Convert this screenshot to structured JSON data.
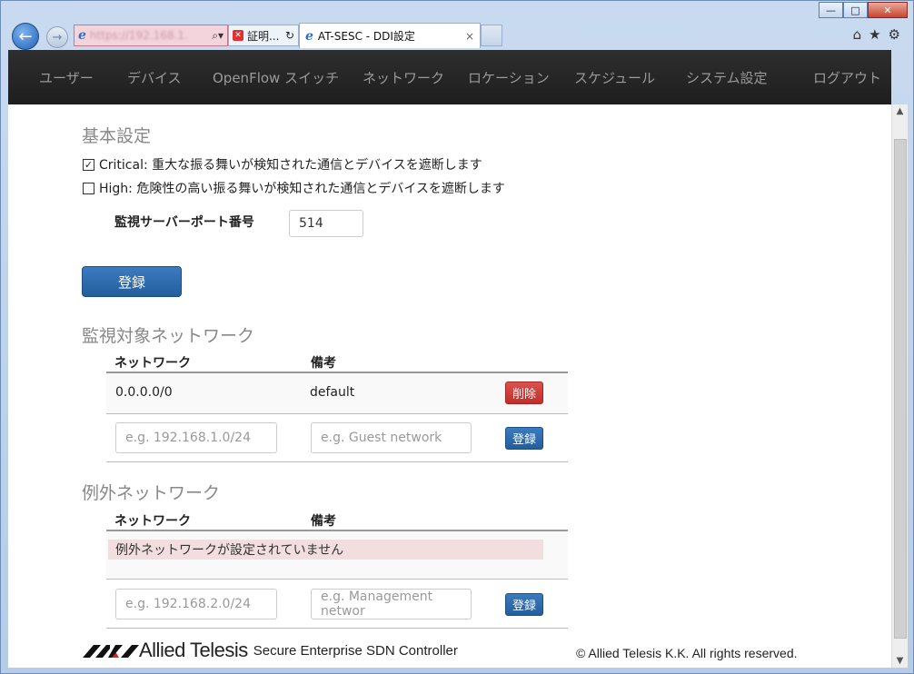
{
  "window": {
    "minimize": "—",
    "maximize": "□",
    "close": "✕"
  },
  "browser": {
    "address_url": "https://192.168.1.",
    "cert_tab_label": "証明...",
    "tab_title": "AT-SESC - DDI設定",
    "tab_close": "×"
  },
  "nav": {
    "items": [
      {
        "label": "ユーザー"
      },
      {
        "label": "デバイス"
      },
      {
        "label": "OpenFlow スイッチ"
      },
      {
        "label": "ネットワーク"
      },
      {
        "label": "ロケーション"
      },
      {
        "label": "スケジュール"
      },
      {
        "label": "システム設定"
      },
      {
        "label": "ログアウト"
      }
    ]
  },
  "basic": {
    "heading": "基本設定",
    "critical": {
      "checked": true,
      "label": "Critical: 重大な振る舞いが検知された通信とデバイスを遮断します"
    },
    "high": {
      "checked": false,
      "label": "High: 危険性の高い振る舞いが検知された通信とデバイスを遮断します"
    },
    "port_label": "監視サーバーポート番号",
    "port_value": "514",
    "register_label": "登録"
  },
  "monitored": {
    "heading": "監視対象ネットワーク",
    "col_network": "ネットワーク",
    "col_note": "備考",
    "rows": [
      {
        "network": "0.0.0.0/0",
        "note": "default",
        "delete_label": "削除"
      }
    ],
    "new_network_placeholder": "e.g. 192.168.1.0/24",
    "new_note_placeholder": "e.g. Guest network",
    "register_label": "登録"
  },
  "exception": {
    "heading": "例外ネットワーク",
    "col_network": "ネットワーク",
    "col_note": "備考",
    "empty_message": "例外ネットワークが設定されていません",
    "new_network_placeholder": "e.g. 192.168.2.0/24",
    "new_note_placeholder": "e.g. Management networ",
    "register_label": "登録"
  },
  "footer": {
    "brand": "Allied Telesis",
    "product": "Secure Enterprise SDN Controller",
    "copyright": "© Allied Telesis K.K. All rights reserved."
  }
}
